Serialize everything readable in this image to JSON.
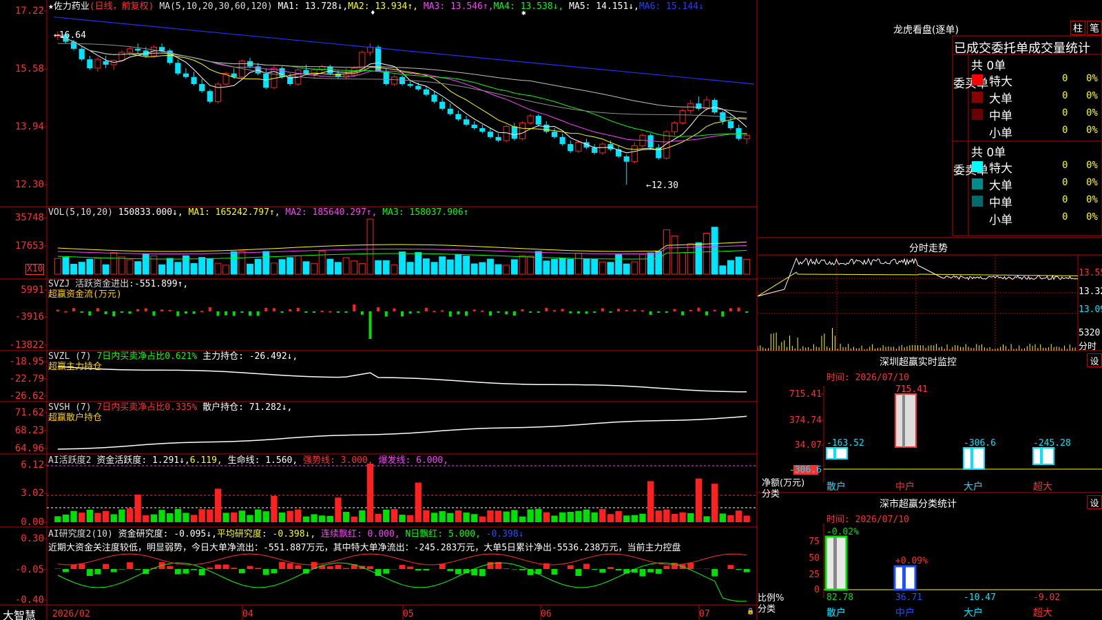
{
  "colors": {
    "up": "#ff2020",
    "down": "#00e5ff",
    "ma1": "#ffffff",
    "ma2": "#ffff00",
    "ma3": "#ff40ff",
    "ma4": "#00ff00",
    "ma5": "#c0c0c0",
    "ma6": "#2030ff",
    "grid": "#c00000"
  },
  "main": {
    "title": "★佐力药业",
    "mode": "(日线，前复权)",
    "ma_params": "MA(5,10,20,30,60,120)",
    "ma1": "MA1: 13.728↓,",
    "ma2": "MA2: 13.934↑,",
    "ma3": "MA3: 13.546↑,",
    "ma4": "MA4: 13.538↓,",
    "ma5": "MA5: 14.151↓,",
    "ma6": "MA6: 15.144↓",
    "y_ticks": [
      "17.22",
      "15.58",
      "13.94",
      "12.30"
    ],
    "high_label": "←16.64",
    "low_label": "←12.30"
  },
  "chart_data": {
    "type": "candlestick",
    "date_start": "2026/02",
    "x_month_labels": [
      "2026/02",
      "04",
      "05",
      "06",
      "07"
    ],
    "ylim": [
      12.0,
      17.3
    ],
    "candles": [
      [
        16.5,
        16.64,
        16.4,
        16.55
      ],
      [
        16.55,
        16.6,
        16.3,
        16.35
      ],
      [
        16.35,
        16.4,
        16.1,
        16.15
      ],
      [
        16.15,
        16.2,
        15.8,
        15.85
      ],
      [
        15.85,
        15.95,
        15.55,
        15.6
      ],
      [
        15.6,
        15.9,
        15.5,
        15.85
      ],
      [
        15.8,
        15.95,
        15.6,
        15.7
      ],
      [
        15.7,
        15.85,
        15.55,
        15.82
      ],
      [
        15.82,
        16.1,
        15.8,
        16.05
      ],
      [
        16.05,
        16.2,
        15.95,
        16.15
      ],
      [
        16.15,
        16.3,
        16.0,
        16.1
      ],
      [
        16.1,
        16.2,
        15.9,
        15.95
      ],
      [
        15.95,
        16.25,
        15.9,
        16.2
      ],
      [
        16.2,
        16.3,
        16.05,
        16.1
      ],
      [
        16.1,
        16.15,
        15.7,
        15.75
      ],
      [
        15.75,
        15.85,
        15.4,
        15.45
      ],
      [
        15.45,
        15.6,
        15.3,
        15.35
      ],
      [
        15.35,
        15.5,
        15.1,
        15.15
      ],
      [
        15.15,
        15.3,
        14.9,
        14.95
      ],
      [
        14.95,
        15.0,
        14.6,
        14.65
      ],
      [
        14.65,
        15.2,
        14.6,
        15.15
      ],
      [
        15.15,
        15.5,
        15.1,
        15.45
      ],
      [
        15.45,
        15.6,
        15.3,
        15.35
      ],
      [
        15.35,
        15.85,
        15.3,
        15.8
      ],
      [
        15.8,
        15.9,
        15.6,
        15.65
      ],
      [
        15.65,
        15.75,
        15.4,
        15.45
      ],
      [
        15.45,
        15.6,
        15.0,
        15.05
      ],
      [
        15.05,
        15.7,
        15.0,
        15.6
      ],
      [
        15.6,
        15.65,
        15.3,
        15.35
      ],
      [
        15.35,
        15.45,
        15.1,
        15.15
      ],
      [
        15.15,
        15.6,
        15.1,
        15.55
      ],
      [
        15.55,
        15.7,
        15.4,
        15.45
      ],
      [
        15.45,
        15.6,
        15.3,
        15.55
      ],
      [
        15.55,
        15.7,
        15.5,
        15.65
      ],
      [
        15.65,
        15.7,
        15.4,
        15.45
      ],
      [
        15.45,
        15.55,
        15.3,
        15.35
      ],
      [
        15.35,
        15.6,
        15.3,
        15.4
      ],
      [
        15.4,
        15.65,
        15.35,
        15.6
      ],
      [
        15.6,
        16.1,
        15.55,
        16.05
      ],
      [
        16.05,
        16.3,
        15.95,
        16.2
      ],
      [
        16.2,
        16.25,
        15.6,
        15.5
      ],
      [
        15.5,
        15.6,
        15.1,
        15.15
      ],
      [
        15.15,
        15.4,
        15.1,
        15.35
      ],
      [
        15.35,
        15.4,
        15.1,
        15.15
      ],
      [
        15.15,
        15.25,
        15.05,
        15.1
      ],
      [
        15.1,
        15.2,
        14.95,
        15.0
      ],
      [
        15.0,
        15.1,
        14.8,
        14.85
      ],
      [
        14.85,
        14.95,
        14.6,
        14.65
      ],
      [
        14.65,
        14.75,
        14.4,
        14.45
      ],
      [
        14.45,
        14.6,
        14.25,
        14.3
      ],
      [
        14.3,
        14.4,
        14.1,
        14.15
      ],
      [
        14.15,
        14.25,
        13.95,
        14.0
      ],
      [
        14.0,
        14.1,
        13.85,
        13.9
      ],
      [
        13.9,
        14.0,
        13.75,
        13.8
      ],
      [
        13.8,
        13.9,
        13.6,
        13.65
      ],
      [
        13.65,
        13.75,
        13.5,
        13.55
      ],
      [
        13.55,
        14.0,
        13.5,
        13.95
      ],
      [
        13.95,
        14.05,
        13.55,
        13.6
      ],
      [
        13.6,
        14.1,
        13.55,
        14.05
      ],
      [
        14.05,
        14.3,
        14.0,
        14.25
      ],
      [
        14.25,
        14.3,
        13.95,
        14.0
      ],
      [
        14.0,
        14.1,
        13.75,
        13.8
      ],
      [
        13.8,
        13.9,
        13.6,
        13.65
      ],
      [
        13.65,
        13.75,
        13.4,
        13.45
      ],
      [
        13.45,
        13.55,
        13.2,
        13.25
      ],
      [
        13.25,
        13.55,
        13.2,
        13.5
      ],
      [
        13.5,
        13.6,
        13.3,
        13.35
      ],
      [
        13.35,
        13.45,
        13.15,
        13.2
      ],
      [
        13.2,
        13.5,
        13.15,
        13.45
      ],
      [
        13.45,
        13.55,
        13.25,
        13.3
      ],
      [
        13.3,
        13.4,
        13.05,
        13.1
      ],
      [
        13.1,
        13.15,
        12.3,
        12.95
      ],
      [
        12.95,
        13.5,
        12.9,
        13.4
      ],
      [
        13.4,
        13.75,
        13.35,
        13.7
      ],
      [
        13.7,
        13.75,
        13.3,
        13.35
      ],
      [
        13.35,
        13.45,
        13.0,
        13.05
      ],
      [
        13.05,
        13.85,
        13.0,
        13.8
      ],
      [
        13.8,
        14.1,
        13.7,
        14.05
      ],
      [
        14.05,
        14.45,
        14.0,
        14.4
      ],
      [
        14.4,
        14.7,
        14.3,
        14.6
      ],
      [
        14.6,
        14.8,
        14.4,
        14.45
      ],
      [
        14.45,
        14.8,
        14.4,
        14.7
      ],
      [
        14.7,
        14.75,
        14.3,
        14.35
      ],
      [
        14.35,
        14.4,
        14.0,
        14.1
      ],
      [
        14.1,
        14.25,
        13.85,
        13.9
      ],
      [
        13.9,
        14.0,
        13.55,
        13.6
      ],
      [
        13.6,
        13.75,
        13.45,
        13.7
      ]
    ],
    "ma_series": [
      "MA1",
      "MA2",
      "MA3",
      "MA4",
      "MA5",
      "MA6"
    ],
    "vol_max": 35748
  },
  "vol": {
    "label": "VOL(5,10,20)",
    "value": "150833.000↓,",
    "ma1": "MA1: 165242.797↑,",
    "ma2": "MA2: 185640.297↑,",
    "ma3": "MA3: 158037.906↑",
    "y_ticks": [
      "35748",
      "17653"
    ],
    "unit": "X10"
  },
  "svzj": {
    "label": "SVZJ  活跃资金进出:",
    "value": "-551.899↑,",
    "sub": "超赢资金流(万元)",
    "y_ticks": [
      "5991",
      "-3916",
      "-13822"
    ]
  },
  "svzl": {
    "label": "SVZL (7)",
    "pct": "7日内买卖净占比0.621%",
    "main": "主力持仓: -26.492↓,",
    "sub": "超赢主力持仓",
    "y_ticks": [
      "-18.95",
      "-22.79",
      "-26.62"
    ]
  },
  "svsh": {
    "label": "SVSH (7)",
    "pct": "7日内买卖净占比0.335%",
    "main": "散户持仓: 71.282↓,",
    "sub": "超赢散户持仓",
    "y_ticks": [
      "71.62",
      "68.23",
      "64.96"
    ]
  },
  "ai1": {
    "label": "AI活跃度2",
    "act": "资金活跃度: 1.291↓,",
    "v2": "6.119,",
    "life": "生命线: 1.560,",
    "strong": "强势线: 3.000,",
    "burst": "爆发线: 6.000,",
    "y_ticks": [
      "6.12",
      "3.02",
      "0.00"
    ]
  },
  "ai2": {
    "label": "AI研究度2(10)",
    "res": "资金研究度: -0.095↓,",
    "avg": "平均研究度: -0.398↓,",
    "lx": "连续飘红: 0.000,",
    "nd": "N日飘红: 5.000,",
    "last": "-0.398↓",
    "y_ticks": [
      "0.30",
      "-0.05",
      "-0.40"
    ],
    "comment": "近期大资金关注度较低，明显弱势，今日大单净流出：-551.887万元，其中特大单净流出：-245.283万元，大单5日累计净出-5536.238万元，当前主力控盘"
  },
  "bottom": {
    "logo": "大智慧",
    "months": [
      "2026/02",
      "04",
      "05",
      "06",
      "07"
    ]
  },
  "right": {
    "lhb_title": "龙虎看盘(逐单)",
    "btn_zhu": "柱",
    "btn_bi": "笔",
    "stat_title": "已成交委托单成交量统计",
    "buy_side": "委买单",
    "sell_side": "委卖单",
    "buy_total": "共 0单",
    "sell_total": "共 0单",
    "rows": [
      {
        "name": "特大",
        "n": "0",
        "p": "0%"
      },
      {
        "name": "大单",
        "n": "0",
        "p": "0%"
      },
      {
        "name": "中单",
        "n": "0",
        "p": "0%"
      },
      {
        "name": "小单",
        "n": "0",
        "p": "0%"
      }
    ],
    "fs_title": "分时走势",
    "fs_prices": [
      "13.55",
      "13.32",
      "13.09"
    ],
    "fs_vol": "5320",
    "fs_unit": "分时",
    "sz_title": "深圳超赢实时监控",
    "set": "设",
    "date_label": "时间: 2026/07/10",
    "sz_top": "715.41",
    "sz_ticks": [
      "715.41",
      "374.74",
      "34.07",
      "-306.6"
    ],
    "sz_values": [
      "-163.52",
      "715.41",
      "-306.6",
      "-245.28"
    ],
    "sz_unit1": "净额(万元)",
    "sz_unit2": "分类",
    "cats": [
      "散户",
      "中户",
      "大户",
      "超大"
    ],
    "cls_title": "深市超赢分类统计",
    "cls_ticks": [
      "75",
      "50",
      "25",
      "0"
    ],
    "cls_top": "-0.02%",
    "cls_mid": "+0.09%",
    "cls_values": [
      "82.78",
      "36.71",
      "-10.47",
      "-9.02"
    ],
    "cls_unit1": "比例%",
    "cls_unit2": "分类"
  }
}
